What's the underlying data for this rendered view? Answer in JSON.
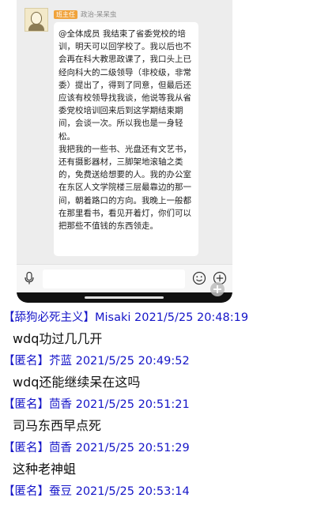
{
  "screenshot": {
    "badge": "班主任",
    "sender": "政治-呆呆虫",
    "message_paragraphs": [
      "@全体成员 我结束了省委党校的培训，明天可以回学校了。我以后也不会再在科大教思政课了，我口头上已经向科大的二级领导（非校级，非常委）提出了，得到了同意，但最后还应该有校领导找我谈，他说等我从省委党校培训回来后到这学期结束期间，会谈一次。所以我也是一身轻松。",
      "我把我的一些书、光盘还有文艺书，还有摄影器材，三脚架地滚轴之类的，免费送给想要的人。我的办公室在东区人文学院楼三层最靠边的那一间，朝着路口的方向。我晚上一般都在那里看书，看见开着灯，你们可以把那些不值钱的东西领走。"
    ]
  },
  "comments": [
    {
      "meta": "【舔狗必死主义】Misaki 2021/5/25 20:48:19",
      "text": "wdq功过几几开"
    },
    {
      "meta": "【匿名】芥蓝 2021/5/25 20:49:52",
      "text": "wdq还能继续呆在这吗"
    },
    {
      "meta": "【匿名】茴香 2021/5/25 20:51:21",
      "text": "司马东西早点死"
    },
    {
      "meta": "【匿名】茴香 2021/5/25 20:51:29",
      "text": "这种老神蛆"
    },
    {
      "meta": "【匿名】蚕豆 2021/5/25 20:53:14",
      "text": ""
    }
  ],
  "icons": {
    "voice": "microphone-icon",
    "emoji": "emoji-icon",
    "more": "plus-circle-icon"
  },
  "colors": {
    "comment_meta": "#1414c8",
    "badge": "#f0a23a"
  }
}
